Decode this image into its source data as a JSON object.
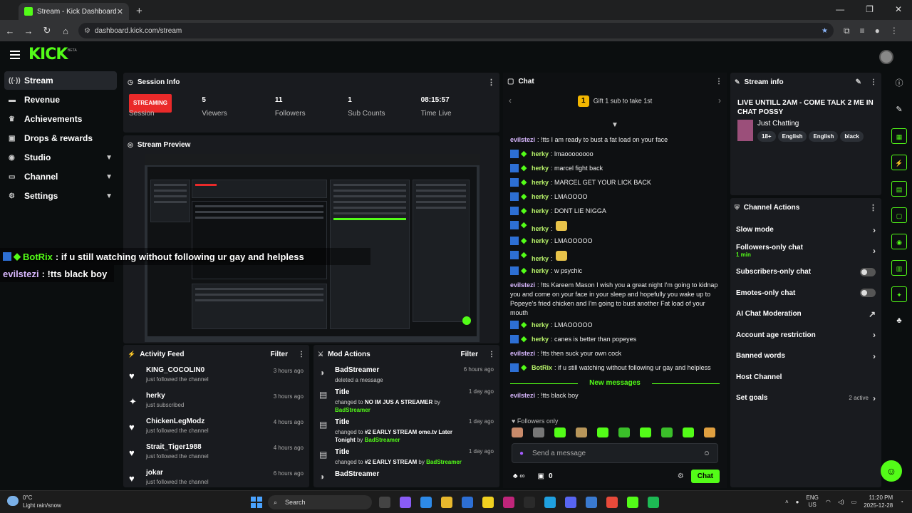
{
  "browser": {
    "tab_title": "Stream - Kick Dashboard",
    "url": "dashboard.kick.com/stream"
  },
  "brand": {
    "logo": "KICK",
    "beta": "BETA",
    "accent": "#53fc18"
  },
  "sidebar": {
    "items": [
      {
        "label": "Stream",
        "icon": "antenna-icon",
        "active": true
      },
      {
        "label": "Revenue",
        "icon": "wallet-icon"
      },
      {
        "label": "Achievements",
        "icon": "trophy-icon"
      },
      {
        "label": "Drops & rewards",
        "icon": "gift-icon"
      },
      {
        "label": "Studio",
        "icon": "palette-icon",
        "expand": true
      },
      {
        "label": "Channel",
        "icon": "monitor-icon",
        "expand": true
      },
      {
        "label": "Settings",
        "icon": "gear-icon",
        "expand": true
      }
    ]
  },
  "session": {
    "title": "Session Info",
    "badge": "STREAMING",
    "stats": [
      {
        "value": "",
        "label": "Session"
      },
      {
        "value": "5",
        "label": "Viewers"
      },
      {
        "value": "11",
        "label": "Followers"
      },
      {
        "value": "1",
        "label": "Sub Counts"
      },
      {
        "value": "08:15:57",
        "label": "Time Live"
      }
    ]
  },
  "preview": {
    "title": "Stream Preview"
  },
  "overlay": [
    {
      "user": "BotRix",
      "text": ": if u still watching without following ur gay and helpless"
    },
    {
      "user": "evilstezi",
      "text": ": !tts black boy"
    }
  ],
  "activity": {
    "title": "Activity Feed",
    "filter": "Filter",
    "items": [
      {
        "name": "KING_COCOLIN0",
        "sub": "just followed the channel",
        "time": "3 hours ago",
        "icon": "heart-icon"
      },
      {
        "name": "herky",
        "sub": "just subscribed",
        "time": "3 hours ago",
        "icon": "star-icon"
      },
      {
        "name": "ChickenLegModz",
        "sub": "just followed the channel",
        "time": "4 hours ago",
        "icon": "heart-icon"
      },
      {
        "name": "Strait_Tiger1988",
        "sub": "just followed the channel",
        "time": "4 hours ago",
        "icon": "heart-icon"
      },
      {
        "name": "jokar",
        "sub": "just followed the channel",
        "time": "6 hours ago",
        "icon": "heart-icon"
      }
    ]
  },
  "mod": {
    "title": "Mod Actions",
    "filter": "Filter",
    "items": [
      {
        "name": "BadStreamer",
        "pre": "deleted a message",
        "bold": "",
        "by": "",
        "time": "6 hours ago"
      },
      {
        "name": "Title",
        "pre": "changed to ",
        "bold": "NO IM JUS A STREAMER",
        "by": "BadStreamer",
        "time": "1 day ago"
      },
      {
        "name": "Title",
        "pre": "changed to ",
        "bold": "#2 EARLY STREAM ome.tv Later Tonight",
        "by": "BadStreamer",
        "time": "1 day ago"
      },
      {
        "name": "Title",
        "pre": "changed to ",
        "bold": "#2 EARLY STREAM",
        "by": "BadStreamer",
        "time": "1 day ago"
      },
      {
        "name": "BadStreamer",
        "pre": "",
        "bold": "",
        "by": "",
        "time": ""
      }
    ],
    "by_word": "by"
  },
  "chat": {
    "title": "Chat",
    "gift_count": "1",
    "gift_text": "Gift 1 sub to take 1st",
    "new_messages": "New messages",
    "messages": [
      {
        "user": "evilstezi",
        "text": "!tts I am ready to bust a fat load on your face",
        "badges": false
      },
      {
        "user": "herky",
        "text": "lmaoooooooo",
        "badges": true
      },
      {
        "user": "herky",
        "text": "marcel fight back",
        "badges": true
      },
      {
        "user": "herky",
        "text": "MARCEL GET YOUR LICK BACK",
        "badges": true
      },
      {
        "user": "herky",
        "text": "LMAOOOO",
        "badges": true
      },
      {
        "user": "herky",
        "text": "DONT LIE NIGGA",
        "badges": true
      },
      {
        "user": "herky",
        "text": "",
        "emote": true,
        "badges": true
      },
      {
        "user": "herky",
        "text": "LMAOOOOO",
        "badges": true
      },
      {
        "user": "herky",
        "text": "",
        "emote": true,
        "badges": true
      },
      {
        "user": "herky",
        "text": "w psychic",
        "badges": true
      },
      {
        "user": "evilstezi",
        "text": "!tts Kareem Mason I wish you a great night I'm going to kidnap you and come on your face in your sleep and hopefully you wake up to Popeye's fried chicken and I'm going to bust another Fat load of your mouth",
        "badges": false
      },
      {
        "user": "herky",
        "text": "LMAOOOOO",
        "badges": true
      },
      {
        "user": "herky",
        "text": "canes is better than popeyes",
        "badges": true
      },
      {
        "user": "evilstezi",
        "text": "!tts then suck your own cock",
        "badges": false
      },
      {
        "user": "BotRix",
        "text": "if u still watching without following ur gay and helpless",
        "badges": true,
        "bot": true
      }
    ],
    "after": [
      {
        "user": "evilstezi",
        "text": "!tts black boy"
      }
    ],
    "followers_only": "Followers only",
    "placeholder": "Send a message",
    "count": "0",
    "send": "Chat"
  },
  "stream_info": {
    "title": "Stream info",
    "stream_title": "LIVE UNTILL 2AM - COME TALK 2 ME IN CHAT POSSY",
    "category": "Just Chatting",
    "tags": [
      "18+",
      "English",
      "English",
      "black"
    ]
  },
  "actions": {
    "title": "Channel Actions",
    "items": [
      {
        "label": "Slow mode",
        "type": "chevron"
      },
      {
        "label": "Followers-only chat",
        "sub": "1 min",
        "type": "chevron"
      },
      {
        "label": "Subscribers-only chat",
        "type": "toggle"
      },
      {
        "label": "Emotes-only chat",
        "type": "toggle"
      },
      {
        "label": "AI Chat Moderation",
        "type": "external"
      },
      {
        "label": "Account age restriction",
        "type": "chevron"
      },
      {
        "label": "Banned words",
        "type": "chevron"
      },
      {
        "label": "Host Channel",
        "type": "none"
      },
      {
        "label": "Set goals",
        "type": "chevron",
        "status": "2 active"
      }
    ]
  },
  "taskbar": {
    "temp": "0°C",
    "weather": "Light rain/snow",
    "search": "Search",
    "lang1": "ENG",
    "lang2": "US",
    "time": "11:20 PM",
    "date": "2025-12-28"
  }
}
